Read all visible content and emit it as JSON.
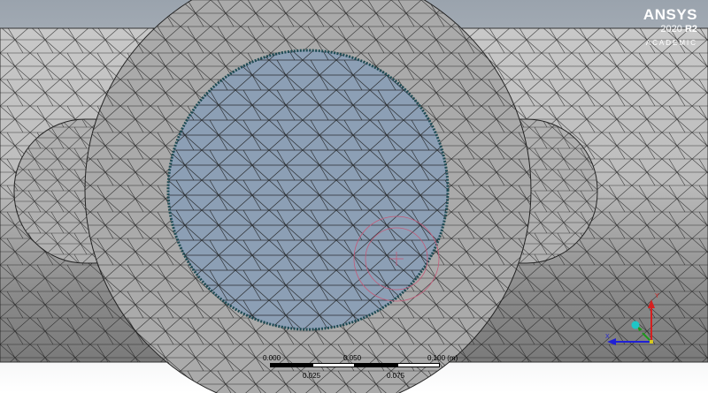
{
  "app": {
    "logo_brand": "ANSYS",
    "logo_version_prefix": "2020 ",
    "logo_version_release": "R2",
    "logo_edition": "ACADEMIC"
  },
  "scale_bar": {
    "labels_top": [
      "0.000",
      "0.050",
      "0.100 (m)"
    ],
    "labels_bottom": [
      "0.025",
      "0.075"
    ]
  },
  "triad": {
    "axes": [
      "X",
      "Y",
      "Z"
    ],
    "colors": {
      "x": "#1f1fd6",
      "y": "#d61f1f",
      "z": "#1a9a1a",
      "ball": "#1fc6c6"
    }
  },
  "colors": {
    "mesh_fill": "#b4b4b4",
    "flange_fill": "#a8a8a8",
    "bore_fill": "#8c9fb5",
    "mesh_line": "#1e1e1e",
    "bore_edge": "#1e4a52",
    "probe_ring": "#c45a78"
  }
}
